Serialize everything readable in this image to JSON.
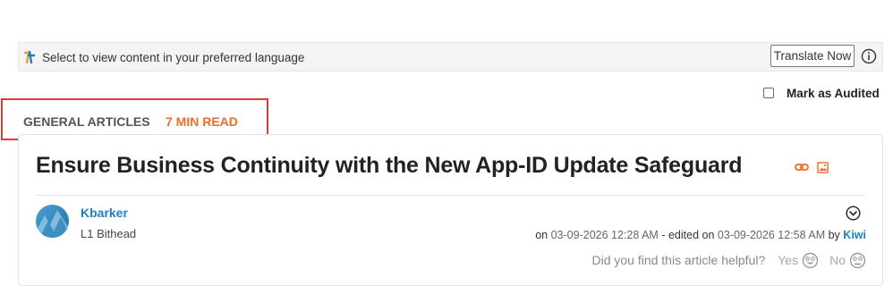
{
  "translate": {
    "prompt": "Select to view content in your preferred language",
    "button": "Translate Now",
    "logo_icon": "translate-logo-icon",
    "info_icon": "info-icon"
  },
  "audit": {
    "label": "Mark as Audited",
    "checked": false
  },
  "article": {
    "category": "GENERAL ARTICLES",
    "read_time": "7 MIN READ",
    "title": "Ensure Business Continuity with the New App-ID Update Safeguard",
    "author": "Kbarker",
    "rank": "L1 Bithead",
    "posted_prefix": "on",
    "posted_date": "03-09-2026 12:28 AM",
    "edited_prefix": "- edited on",
    "edited_date": "03-09-2026 12:58 AM",
    "edited_by_prefix": "by",
    "editor": "Kiwi",
    "helpful_question": "Did you find this article helpful?",
    "yes_label": "Yes",
    "no_label": "No"
  },
  "colors": {
    "accent_orange": "#f06a2b",
    "link_blue": "#1c7fc4",
    "highlight_red": "#e53935"
  }
}
